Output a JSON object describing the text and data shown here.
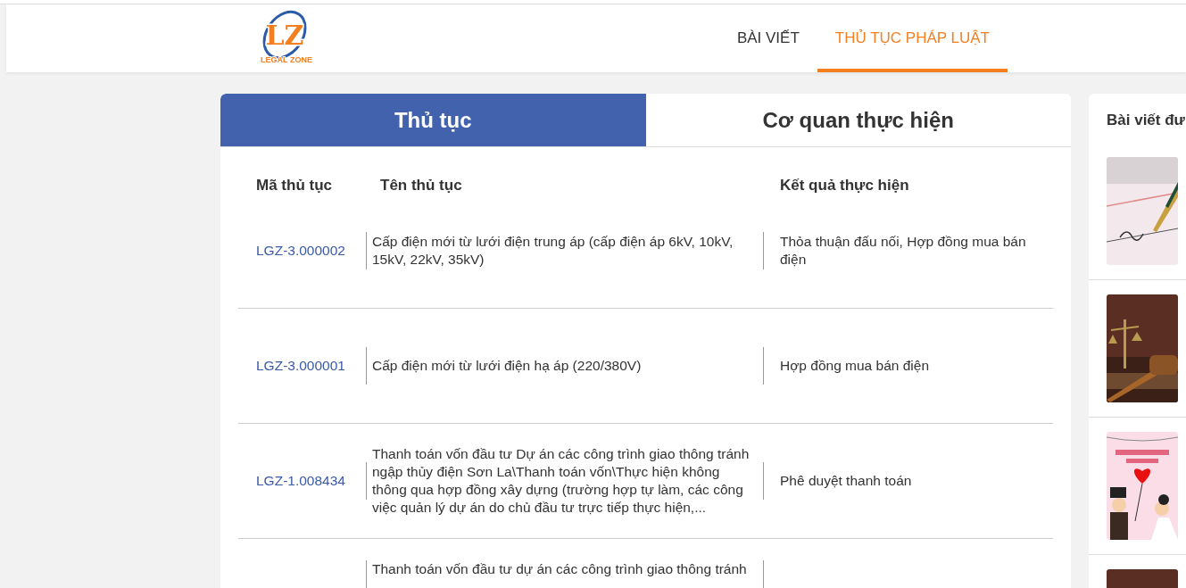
{
  "logo": {
    "text": "LZ",
    "tagline": "LEGAL ZONE"
  },
  "nav": [
    {
      "label": "BÀI VIẾT",
      "selected": false
    },
    {
      "label": "THỦ TỤC PHÁP LUẬT",
      "selected": true
    }
  ],
  "tabs": [
    {
      "label": "Thủ tục",
      "selected": true
    },
    {
      "label": "Cơ quan thực hiện",
      "selected": false
    }
  ],
  "table": {
    "columns": [
      "Mã thủ tục",
      "Tên thủ tục",
      "Kết quả thực hiện"
    ],
    "rows": [
      {
        "code": "LGZ-3.000002",
        "name": "Cấp điện mới từ lưới điện trung áp (cấp điện áp 6kV, 10kV, 15kV, 22kV, 35kV)",
        "result": "Thỏa thuận đấu nối, Hợp đồng mua bán điện"
      },
      {
        "code": "LGZ-3.000001",
        "name": "Cấp điện mới từ lưới điện hạ áp (220/380V)",
        "result": "Hợp đồng mua bán điện"
      },
      {
        "code": "LGZ-1.008434",
        "name": "Thanh toán vốn đầu tư Dự án các công trình giao thông tránh ngập thủy điện Sơn La\\Thanh toán vốn\\Thực hiện không thông qua hợp đồng xây dựng (trường hợp tự làm, các công việc quản lý dự án do chủ đầu tư trực tiếp thực hiện,...",
        "result": "Phê duyệt thanh toán"
      },
      {
        "name": "Thanh toán vốn đầu tư dự án các công trình giao thông tránh"
      }
    ]
  },
  "sidebar": {
    "title": "Bài viết đư"
  }
}
